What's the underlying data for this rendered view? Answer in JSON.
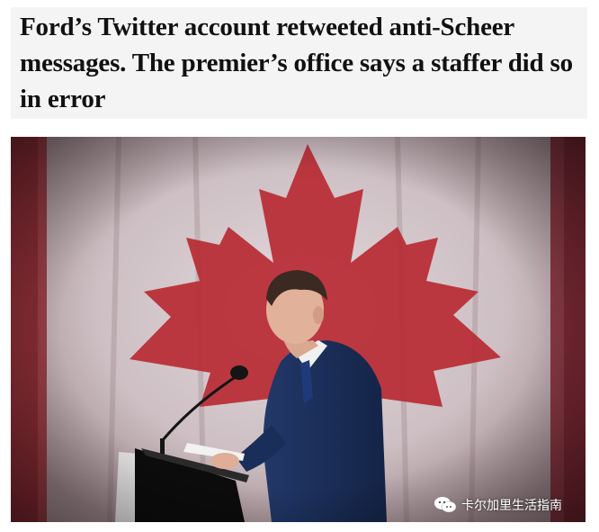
{
  "article": {
    "headline": "Ford’s Twitter account retweeted anti-Scheer messages. The premier’s office says a staffer did so in error"
  },
  "photo": {
    "subject": "man-at-podium-in-front-of-canadian-flag",
    "colors": {
      "flag_red": "#b82a33",
      "flag_white": "#dcd3d6",
      "suit": "#1c2f5c"
    }
  },
  "watermark": {
    "icon": "wechat-icon",
    "label": "卡尔加里生活指南"
  }
}
